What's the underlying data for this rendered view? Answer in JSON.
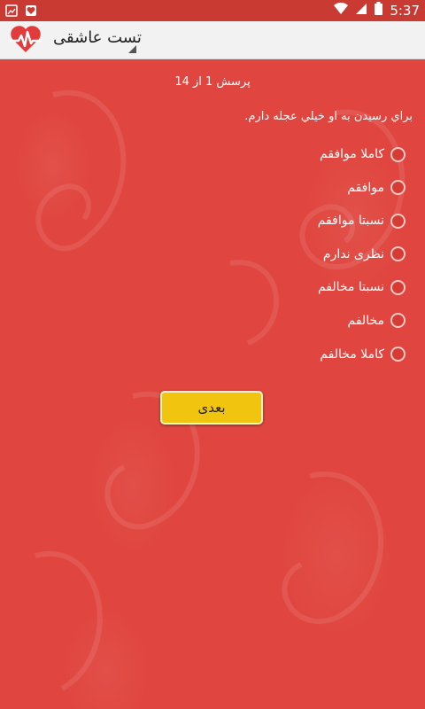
{
  "status_bar": {
    "time": "5:37"
  },
  "app_bar": {
    "title": "تست عاشقی"
  },
  "quiz": {
    "counter": "پرسش 1 از 14",
    "question": "براي رسيدن به او خيلي عجله دارم.",
    "options": [
      "کاملا موافقم",
      "موافقم",
      "نسبتا موافقم",
      "نظری ندارم",
      "نسبتا مخالفم",
      "مخالفم",
      "کاملا مخالفم"
    ],
    "next_label": "بعدی"
  },
  "colors": {
    "background": "#e0463f",
    "status_bar": "#c93a33",
    "app_bar": "#f2f2f2",
    "button": "#f1c40f"
  }
}
